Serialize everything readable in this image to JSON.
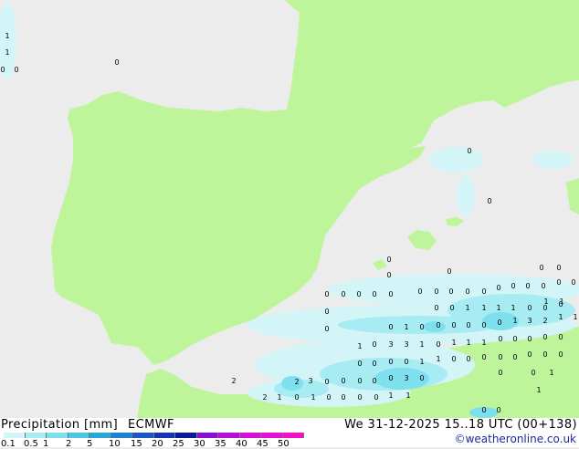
{
  "header": {
    "title": "Precipitation",
    "units": "[mm]",
    "model": "ECMWF",
    "valid_time": "We 31-12-2025 15..18 UTC (00+138)",
    "credit": "©weatheronline.co.uk"
  },
  "legend": {
    "labels": [
      "0.1",
      "0.5",
      "1",
      "2",
      "5",
      "10",
      "15",
      "20",
      "25",
      "30",
      "35",
      "40",
      "45",
      "50"
    ],
    "colors": [
      "#d3f5f7",
      "#a6ecf2",
      "#7de0ec",
      "#4cc7e3",
      "#2aa7d9",
      "#1f7fd1",
      "#1c58c4",
      "#1733b4",
      "#0a1a97",
      "#8a0fd1",
      "#b30fd6",
      "#d40fd8",
      "#e60fd6",
      "#f20fc8"
    ]
  },
  "map": {
    "land_color": "#bff59a",
    "sea_color": "#ececec",
    "precip_values": [
      "1",
      "1",
      "0",
      "0",
      "0",
      "0",
      "0",
      "0",
      "0",
      "0",
      "0",
      "0",
      "0",
      "0",
      "0",
      "0",
      "0",
      "0",
      "0",
      "0",
      "0",
      "0",
      "0",
      "0",
      "0",
      "0",
      "0",
      "0",
      "1",
      "1",
      "0",
      "0",
      "0",
      "1",
      "1",
      "1",
      "1",
      "0",
      "0",
      "0",
      "0",
      "0",
      "1",
      "0",
      "0",
      "0",
      "0",
      "0",
      "0",
      "1",
      "3",
      "2",
      "1",
      "1",
      "1",
      "0",
      "3",
      "3",
      "1",
      "0",
      "1",
      "1",
      "1",
      "0",
      "0",
      "0",
      "0",
      "0",
      "0",
      "0",
      "0",
      "0",
      "1",
      "1",
      "0",
      "0",
      "0",
      "0",
      "0",
      "0",
      "0",
      "0",
      "2",
      "3",
      "2",
      "0",
      "0",
      "0",
      "0",
      "0",
      "3",
      "0",
      "0",
      "0",
      "1",
      "2",
      "1",
      "0",
      "1",
      "0",
      "0",
      "0",
      "0",
      "1",
      "1",
      "1",
      "0",
      "0",
      "0",
      "0",
      "0",
      "2",
      "0"
    ]
  }
}
